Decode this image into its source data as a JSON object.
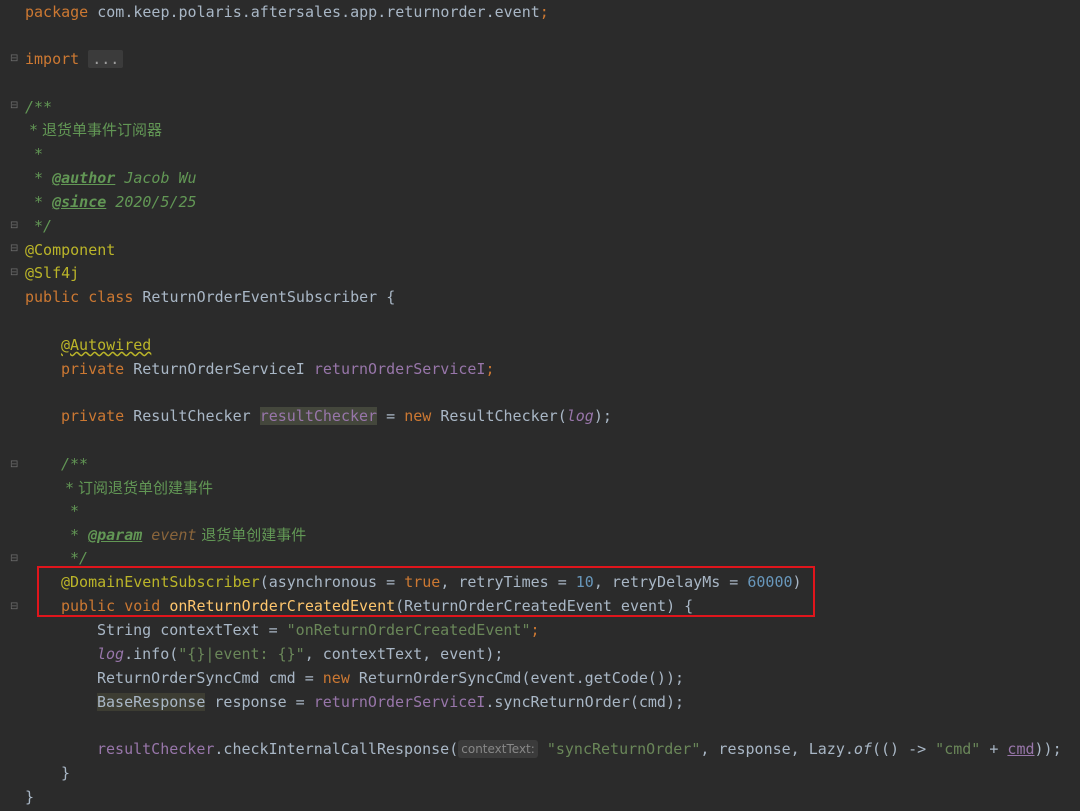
{
  "code": {
    "package_kw": "package",
    "package_name": "com.keep.polaris.aftersales.app.returnorder.event",
    "semicolon": ";",
    "import_kw": "import",
    "import_folded": "...",
    "doc_open": "/**",
    "doc_desc": " * 退货单事件订阅器",
    "doc_star": " *",
    "doc_author_prefix": " * ",
    "doc_author_tag": "@author",
    "doc_author_val": " Jacob Wu",
    "doc_since_prefix": " * ",
    "doc_since_tag": "@since",
    "doc_since_val": " 2020/5/25",
    "doc_close": " */",
    "ann_component": "@Component",
    "ann_slf4j": "@Slf4j",
    "class_decl_kw": "public class ",
    "class_name": "ReturnOrderEventSubscriber {",
    "ann_autowired": "@Autowired",
    "field1_kw": "private ",
    "field1_type": "ReturnOrderServiceI ",
    "field1_name": "returnOrderServiceI",
    "field2_kw": "private ",
    "field2_type": "ResultChecker ",
    "field2_name": "resultChecker",
    "field2_assign": " = ",
    "field2_new": "new ",
    "field2_ctor": "ResultChecker(",
    "field2_log": "log",
    "field2_end": ");",
    "mdoc_open": "/**",
    "mdoc_desc": " * 订阅退货单创建事件",
    "mdoc_star": " *",
    "mdoc_param_prefix": " * ",
    "mdoc_param_tag": "@param",
    "mdoc_param_name": " event",
    "mdoc_param_desc": " 退货单创建事件",
    "mdoc_close": " */",
    "ann_des": "@DomainEventSubscriber",
    "ann_des_args_1": "(asynchronous = ",
    "ann_des_true": "true",
    "ann_des_args_2": ", retryTimes = ",
    "ann_des_10": "10",
    "ann_des_args_3": ", retryDelayMs = ",
    "ann_des_60000": "60000",
    "ann_des_close": ")",
    "method_kw": "public void ",
    "method_name": "onReturnOrderCreatedEvent",
    "method_params": "(ReturnOrderCreatedEvent event) {",
    "l1_type": "String contextText = ",
    "l1_str": "\"onReturnOrderCreatedEvent\"",
    "l1_end": ";",
    "l2_log": "log",
    "l2_call": ".info(",
    "l2_str": "\"{}|event: {}\"",
    "l2_args": ", contextText, event);",
    "l3_a": "ReturnOrderSyncCmd cmd = ",
    "l3_new": "new ",
    "l3_b": "ReturnOrderSyncCmd(event.getCode());",
    "l4_type": "BaseResponse",
    "l4_a": " response = ",
    "l4_field": "returnOrderServiceI",
    "l4_b": ".syncReturnOrder(cmd);",
    "l5_field": "resultChecker",
    "l5_a": ".checkInternalCallResponse(",
    "l5_hint": "contextText:",
    "l5_str": "\"syncReturnOrder\"",
    "l5_b": ", response, Lazy.",
    "l5_of": "of",
    "l5_c": "(() -> ",
    "l5_str2": "\"cmd\"",
    "l5_d": " + ",
    "l5_cmd": "cmd",
    "l5_e": "));",
    "close_method": "}",
    "close_class": "}"
  }
}
